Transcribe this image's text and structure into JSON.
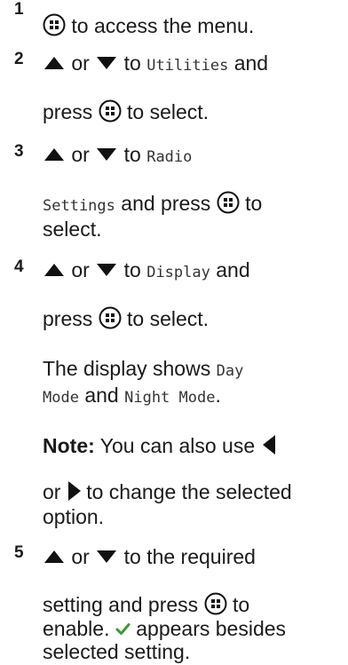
{
  "steps": [
    {
      "num": "1",
      "text_a": "to access the menu."
    },
    {
      "num": "2",
      "or": "or",
      "to": "to",
      "target": "Utilities",
      "and": "and",
      "press": "press",
      "end": "to select."
    },
    {
      "num": "3",
      "or": "or",
      "to": "to",
      "target_a": "Radio",
      "target_b": "Settings",
      "and_press": "and press",
      "to_word": "to",
      "end": "select."
    },
    {
      "num": "4",
      "or": "or",
      "to": "to",
      "target": "Display",
      "and": "and",
      "press": "press",
      "end": "to select."
    },
    {
      "num": "5",
      "or": "or",
      "to_rest": "to the required",
      "setting_text": "setting and press",
      "to_word": "to",
      "enable": "enable.",
      "appears": "appears besides",
      "selected": "selected setting."
    }
  ],
  "display_info": {
    "prefix": "The display shows",
    "mode_day_a": "Day",
    "mode_day_b": "Mode",
    "and": "and",
    "mode_night": "Night Mode",
    "end": "."
  },
  "note": {
    "label": "Note:",
    "text_a": "You can also use",
    "or": "or",
    "text_b": "to change the selected",
    "text_c": "option."
  },
  "icons": {
    "menu_button": "menu-ok-button-icon",
    "up_arrow": "up-arrow-icon",
    "down_arrow": "down-arrow-icon",
    "left_arrow": "left-arrow-icon",
    "right_arrow": "right-arrow-icon",
    "checkmark": "checkmark-icon",
    "check_color": "#3a9a3a"
  }
}
